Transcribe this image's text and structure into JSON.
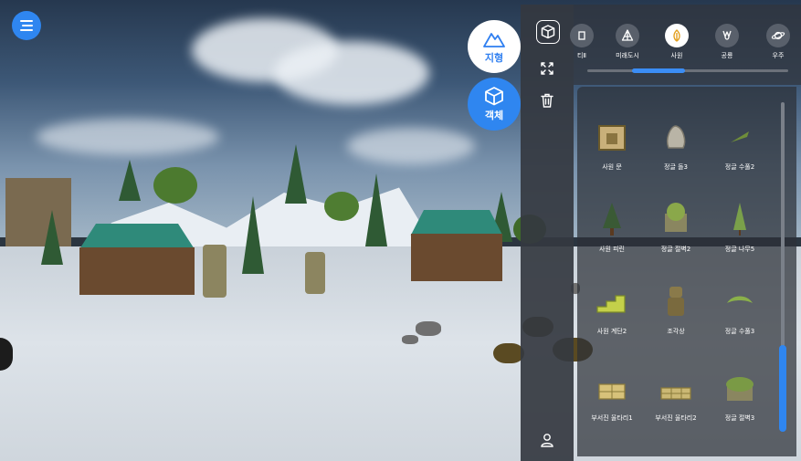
{
  "hud": {
    "terrain_label": "지형",
    "object_label": "객체"
  },
  "categories": [
    {
      "label": "티Ⅱ",
      "icon": "partial-icon"
    },
    {
      "label": "미래도시",
      "icon": "city-icon"
    },
    {
      "label": "사원",
      "icon": "temple-icon",
      "active": true
    },
    {
      "label": "공룡",
      "icon": "dinosaur-icon"
    },
    {
      "label": "우주",
      "icon": "planet-icon"
    }
  ],
  "items": [
    {
      "name": "사원 문",
      "color": "#c9b07a"
    },
    {
      "name": "정글 돌3",
      "color": "#b9b4a6"
    },
    {
      "name": "정글 수풀2",
      "color": "#6f8e3a"
    },
    {
      "name": "사원 피린",
      "color": "#3a5a35"
    },
    {
      "name": "정글 절벽2",
      "color": "#8aa84a"
    },
    {
      "name": "정글 나무5",
      "color": "#7aa04a"
    },
    {
      "name": "사원 계단2",
      "color": "#c4d04a"
    },
    {
      "name": "조각상",
      "color": "#8a7a4a"
    },
    {
      "name": "정글 수풀3",
      "color": "#8ab04a"
    },
    {
      "name": "부서진 울타리1",
      "color": "#d7c27a"
    },
    {
      "name": "부서진 울타리2",
      "color": "#cbb874"
    },
    {
      "name": "정글 절벽3",
      "color": "#7a9a45"
    }
  ],
  "colors": {
    "accent": "#2f86f0",
    "panel": "#34383f"
  }
}
